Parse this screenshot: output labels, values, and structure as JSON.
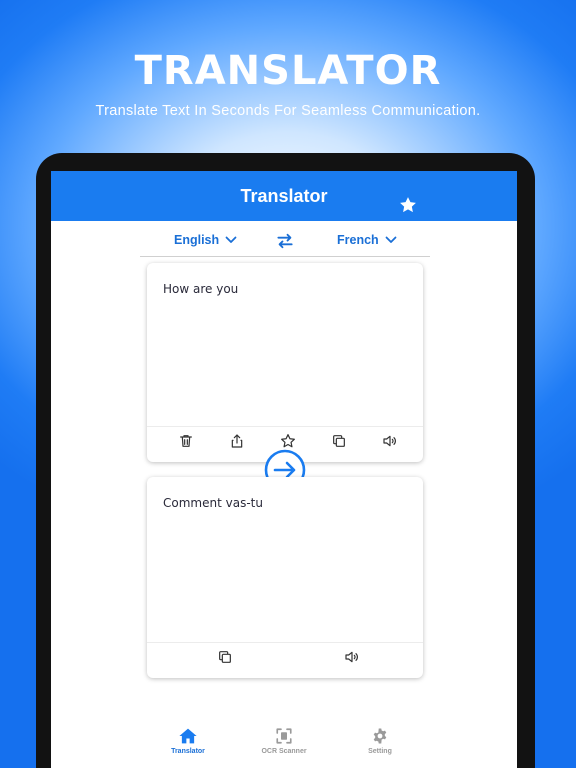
{
  "hero": {
    "title": "TRANSLATOR",
    "subtitle": "Translate Text In Seconds For Seamless Communication."
  },
  "app": {
    "title": "Translator",
    "title_icon": "star-icon"
  },
  "languages": {
    "source": "English",
    "target": "French",
    "swap_icon": "swap-arrows-icon"
  },
  "input_card": {
    "text": "How are you",
    "tools": [
      "delete-icon",
      "share-icon",
      "favorite-star-icon",
      "copy-icon",
      "speaker-icon"
    ]
  },
  "output_card": {
    "text": "Comment vas-tu",
    "tools": [
      "copy-icon",
      "speaker-icon"
    ]
  },
  "translate_button_icon": "arrow-right-circle-icon",
  "bottom_nav": {
    "items": [
      {
        "label": "Translator",
        "icon": "home-icon",
        "active": true
      },
      {
        "label": "OCR Scanner",
        "icon": "scanner-icon",
        "active": false
      },
      {
        "label": "Setting",
        "icon": "gear-icon",
        "active": false
      }
    ]
  },
  "colors": {
    "primary": "#1a7cf0",
    "accent_text": "#1a6fd6",
    "inactive": "#9a9a9a"
  }
}
